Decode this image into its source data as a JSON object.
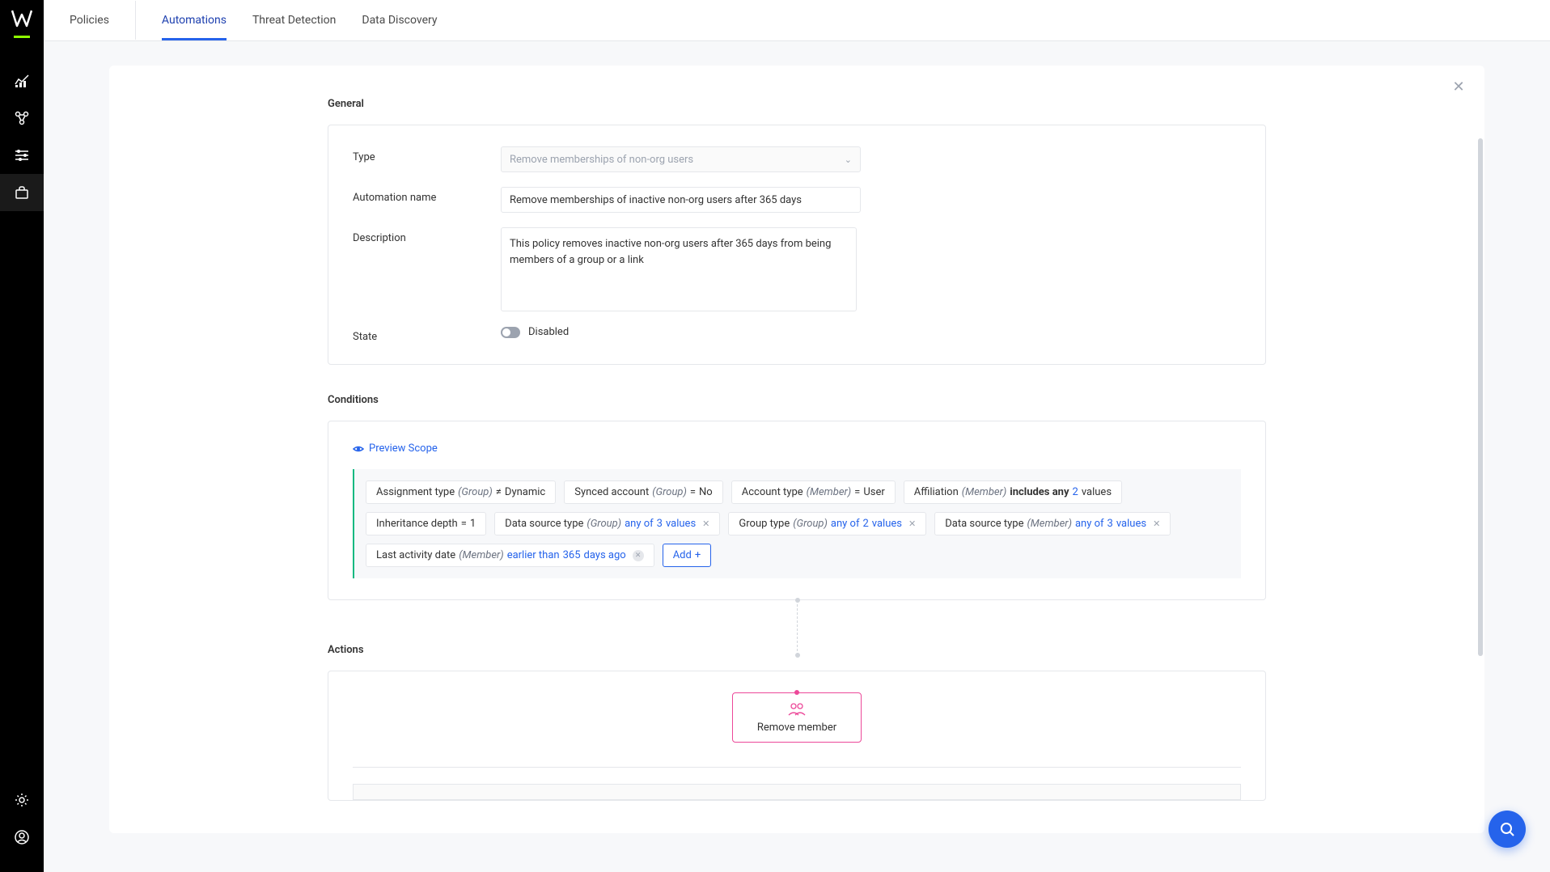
{
  "nav": {
    "policies": "Policies",
    "automations": "Automations",
    "threat_detection": "Threat Detection",
    "data_discovery": "Data Discovery"
  },
  "sections": {
    "general": "General",
    "conditions": "Conditions",
    "actions": "Actions"
  },
  "general": {
    "type_label": "Type",
    "type_value": "Remove memberships of non-org users",
    "name_label": "Automation name",
    "name_value": "Remove memberships of inactive non-org users after 365 days",
    "description_label": "Description",
    "description_value": "This policy removes inactive non-org users after 365 days from being members of a group or a link",
    "state_label": "State",
    "state_value": "Disabled"
  },
  "conditions": {
    "preview_scope": "Preview Scope",
    "chips": [
      {
        "field": "Assignment type",
        "scope": "(Group)",
        "op": "≠",
        "val": "Dynamic",
        "removable": false
      },
      {
        "field": "Synced account",
        "scope": "(Group)",
        "op": "=",
        "val": "No",
        "removable": false
      },
      {
        "field": "Account type",
        "scope": "(Member)",
        "op": "=",
        "val": "User",
        "removable": false
      },
      {
        "field": "Affiliation",
        "scope": "(Member)",
        "op_text": "includes any",
        "count": "2",
        "tail": "values",
        "removable": false
      },
      {
        "field": "Inheritance depth",
        "scope": "",
        "op": "=",
        "val": "1",
        "removable": false
      },
      {
        "field": "Data source type",
        "scope": "(Group)",
        "link_pre": "any of",
        "count": "3",
        "tail": "values",
        "removable": true
      },
      {
        "field": "Group type",
        "scope": "(Group)",
        "link_pre": "any of",
        "count": "2",
        "tail": "values",
        "removable": true
      },
      {
        "field": "Data source type",
        "scope": "(Member)",
        "link_pre": "any of",
        "count": "3",
        "tail": "values",
        "removable": true
      },
      {
        "field": "Last activity date",
        "scope": "(Member)",
        "link_pre": "earlier than",
        "count": "365",
        "tail": "days ago",
        "removable": true,
        "warn": true
      }
    ],
    "add_label": "Add"
  },
  "action": {
    "label": "Remove member"
  }
}
